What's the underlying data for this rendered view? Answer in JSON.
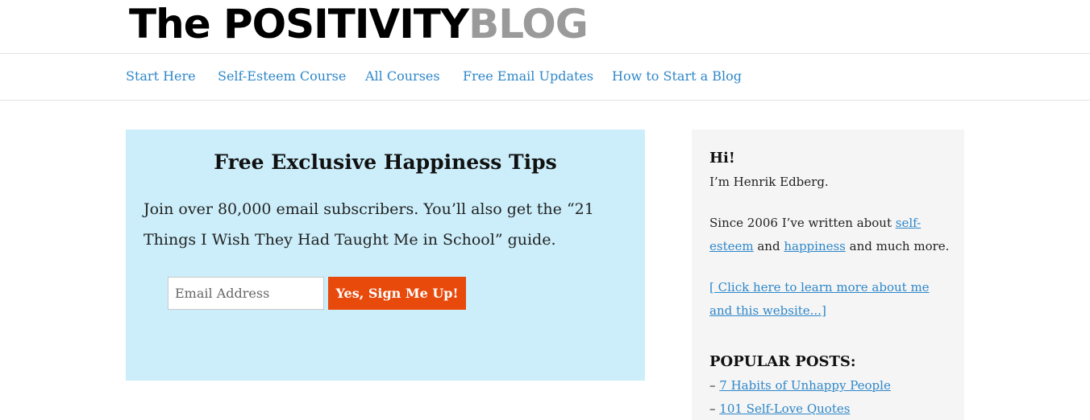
{
  "logo": {
    "part1": "The POSITIVITY",
    "part2": "BLOG"
  },
  "nav": {
    "items": [
      {
        "label": "Start Here"
      },
      {
        "label": "Self-Esteem Course"
      },
      {
        "label": "All Courses"
      },
      {
        "label": "Free Email Updates"
      },
      {
        "label": "How to Start a Blog"
      }
    ]
  },
  "optin": {
    "title": "Free Exclusive Happiness Tips",
    "text": "Join over 80,000 email subscribers. You’ll also get the “21 Things I Wish They Had Taught Me in School” guide.",
    "email_placeholder": "Email Address",
    "button_label": "Yes, Sign Me Up!"
  },
  "sidebar": {
    "greeting": "Hi!",
    "intro": "I’m Henrik Edberg.",
    "since_prefix": "Since 2006 I’ve written about ",
    "link_self": "self-",
    "link_esteem": "esteem",
    "and_text": " and ",
    "link_happiness": "happiness",
    "tail_text": " and much more.",
    "about_line1": "[ Click here to learn more about me",
    "about_line2": "and this website...]",
    "popular_heading": "POPULAR POSTS:",
    "dash": "– ",
    "posts": [
      {
        "label": "7 Habits of Unhappy People"
      },
      {
        "label": "101 Self-Love Quotes"
      }
    ]
  },
  "colors": {
    "link": "#2e87c9",
    "optin_bg": "#cbeefa",
    "button": "#e84a0c",
    "sidebar_bg": "#f5f5f5"
  }
}
